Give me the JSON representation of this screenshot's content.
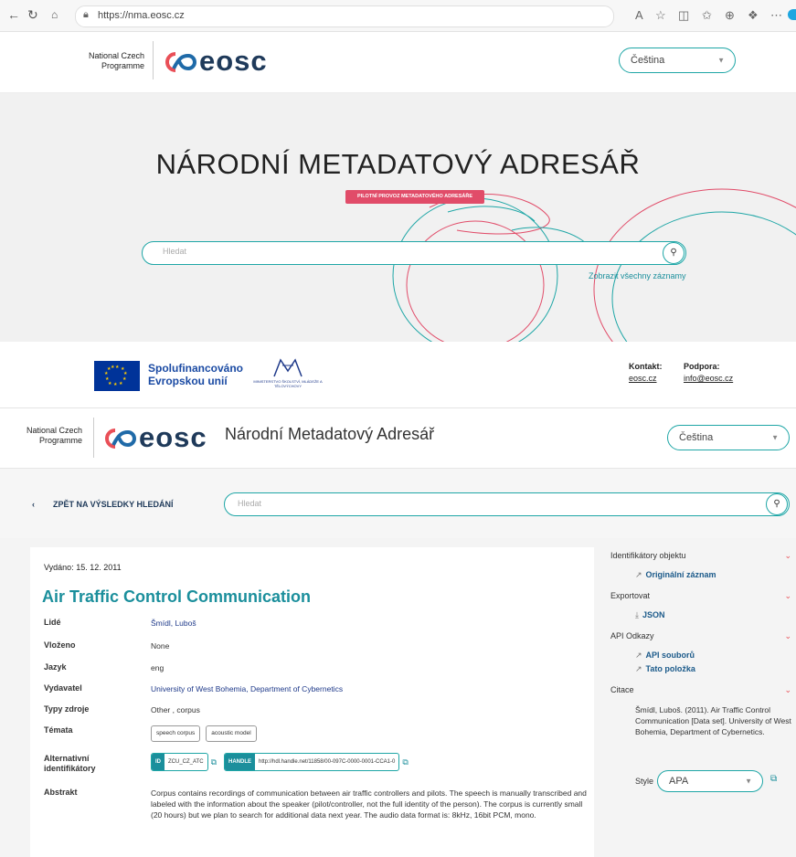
{
  "browser": {
    "url": "https://nma.eosc.cz"
  },
  "header": {
    "ncp": [
      "National Czech",
      "Programme"
    ],
    "logo": "eosc",
    "language": "Čeština"
  },
  "hero": {
    "title": "NÁRODNÍ METADATOVÝ ADRESÁŘ",
    "pilot_badge": "PILOTNÍ PROVOZ METADATOVÉHO ADRESÁŘE",
    "search_placeholder": "Hledat",
    "show_all": "Zobrazit všechny záznamy"
  },
  "footer": {
    "eu_line1": "Spolufinancováno",
    "eu_line2": "Evropskou unií",
    "msmt_text": "MINISTERSTVO ŠKOLSTVÍ, MLÁDEŽE A TĚLOVÝCHOVY",
    "contact_label": "Kontakt:",
    "contact_link": "eosc.cz",
    "support_label": "Podpora:",
    "support_link": "info@eosc.cz"
  },
  "header2": {
    "ncp": [
      "National Czech",
      "Programme"
    ],
    "logo": "eosc",
    "app_title": "Národní Metadatový Adresář",
    "language": "Čeština"
  },
  "toolbar": {
    "back_label": "ZPĚT NA VÝSLEDKY HLEDÁNÍ",
    "search_placeholder": "Hledat"
  },
  "record": {
    "published_label": "Vydáno:",
    "published": "15. 12. 2011",
    "title": "Air Traffic Control Communication",
    "fields": {
      "people_label": "Lidé",
      "people": "Šmídl, Luboš",
      "inserted_label": "Vloženo",
      "inserted": "None",
      "language_label": "Jazyk",
      "language": "eng",
      "publisher_label": "Vydavatel",
      "publisher": "University of West Bohemia, Department of Cybernetics",
      "types_label": "Typy zdroje",
      "types": "Other , corpus",
      "topics_label": "Témata",
      "topics": [
        "speech corpus",
        "acoustic model"
      ],
      "altid_label_1": "Alternativní",
      "altid_label_2": "identifikátory",
      "id_key": "ID",
      "id_value": "ZCU_CZ_ATC",
      "handle_key": "HANDLE",
      "handle_value": "http://hdl.handle.net/11858/00-097C-0000-0001-CCA1-0",
      "abstract_label": "Abstrakt",
      "abstract": "Corpus contains recordings of communication between air traffic controllers and pilots. The speech is manually transcribed and labeled with the information about the speaker (pilot/controller, not the full identity of the person). The corpus is currently small (20 hours) but we plan to search for additional data next year. The audio data format is: 8kHz, 16bit PCM, mono."
    }
  },
  "sidebar": {
    "identifiers_label": "Identifikátory objektu",
    "original_record": "Originální záznam",
    "export_label": "Exportovat",
    "json": "JSON",
    "api_label": "API Odkazy",
    "api_files": "API souborů",
    "this_item": "Tato položka",
    "citation_label": "Citace",
    "citation": "Šmídl, Luboš. (2011). Air Traffic Control Communication [Data set]. University of West Bohemia, Department of Cybernetics.",
    "style_label": "Style",
    "style_value": "APA"
  },
  "colors": {
    "accent": "#1ea6a6",
    "brand_red": "#e94f57",
    "pilot": "#e14c69",
    "navy": "#1f3a5a"
  }
}
